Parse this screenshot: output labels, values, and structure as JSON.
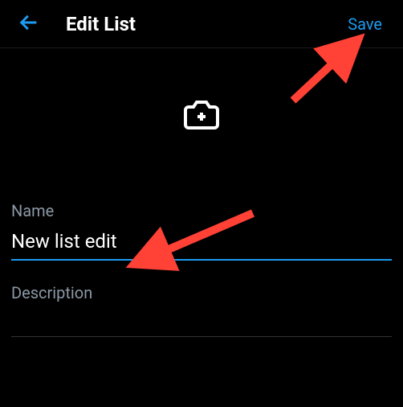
{
  "header": {
    "title": "Edit List",
    "save_label": "Save"
  },
  "form": {
    "name_label": "Name",
    "name_value": "New list edit",
    "description_label": "Description"
  },
  "colors": {
    "accent": "#1d9bf0",
    "annotation": "#ff4136"
  }
}
